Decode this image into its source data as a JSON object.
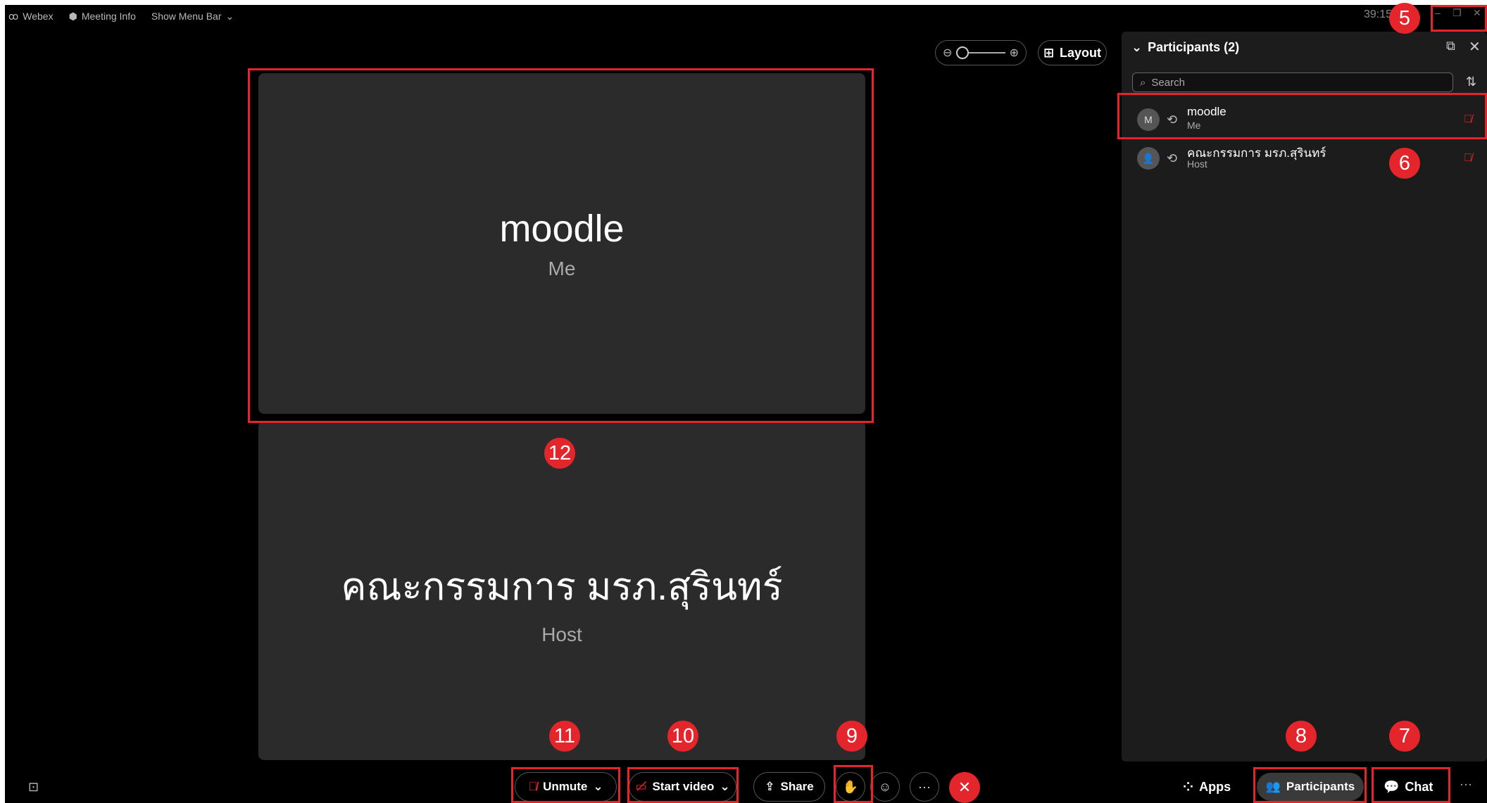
{
  "menubar": {
    "app_name": "Webex",
    "meeting_info": "Meeting Info",
    "show_menu_bar": "Show Menu Bar"
  },
  "timer": "39:15",
  "annotations": [
    "5",
    "6",
    "7",
    "8",
    "9",
    "10",
    "11",
    "12"
  ],
  "layout_label": "Layout",
  "tiles": [
    {
      "name": "moodle",
      "role": "Me"
    },
    {
      "name": "คณะกรรมการ มรภ.สุรินทร์",
      "role": "Host"
    }
  ],
  "participants_panel": {
    "title": "Participants (2)",
    "search_placeholder": "Search",
    "participants": [
      {
        "initial": "M",
        "name": "moodle",
        "role": "Me"
      },
      {
        "initial": "",
        "name": "คณะกรรมการ มรภ.สุรินทร์",
        "role": "Host"
      }
    ]
  },
  "controls": {
    "unmute": "Unmute",
    "start_video": "Start video",
    "share": "Share",
    "apps": "Apps",
    "participants": "Participants",
    "chat": "Chat"
  },
  "colors": {
    "annotation_red": "#e4252b",
    "panel_bg": "#1c1c1c",
    "tile_bg": "#2b2b2b"
  }
}
